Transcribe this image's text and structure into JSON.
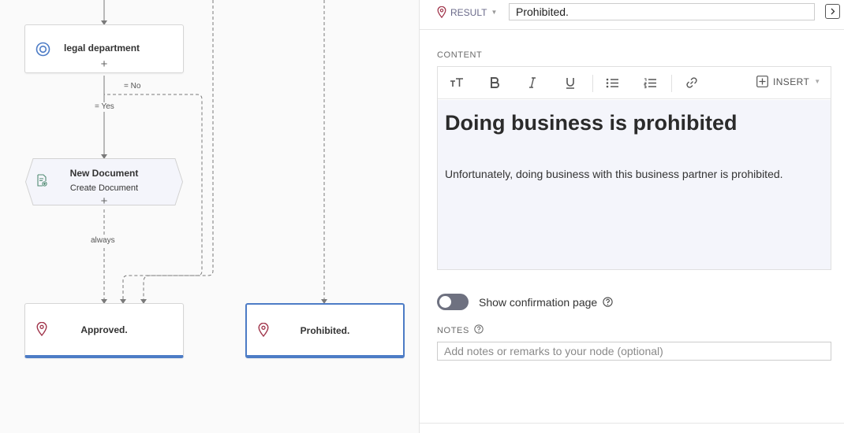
{
  "canvas": {
    "nodes": {
      "legal": {
        "title": "legal department",
        "icon": "target-icon",
        "plus": "+"
      },
      "new_document": {
        "title": "New Document",
        "subtitle": "Create Document",
        "icon": "document-add-icon",
        "plus": "+"
      },
      "approved": {
        "title": "Approved.",
        "icon": "location-pin-icon"
      },
      "prohibited": {
        "title": "Prohibited.",
        "icon": "location-pin-icon"
      }
    },
    "edge_labels": {
      "no": "= No",
      "yes": "= Yes",
      "always": "always"
    }
  },
  "panel": {
    "result_tag": "RESULT",
    "result_value": "Prohibited.",
    "content_label": "CONTENT",
    "toolbar": {
      "insert_label": "INSERT"
    },
    "editor": {
      "heading": "Doing business is prohibited",
      "paragraph": "Unfortunately, doing business with this business partner is prohibited."
    },
    "toggle": {
      "label": "Show confirmation page",
      "on": false
    },
    "notes": {
      "label": "NOTES",
      "placeholder": "Add notes or remarks to your node (optional)"
    }
  },
  "colors": {
    "accent": "#4d7cc6",
    "pin": "#a0344a",
    "editor_bg": "#f4f5fb",
    "toggle_off": "#6e7180"
  }
}
